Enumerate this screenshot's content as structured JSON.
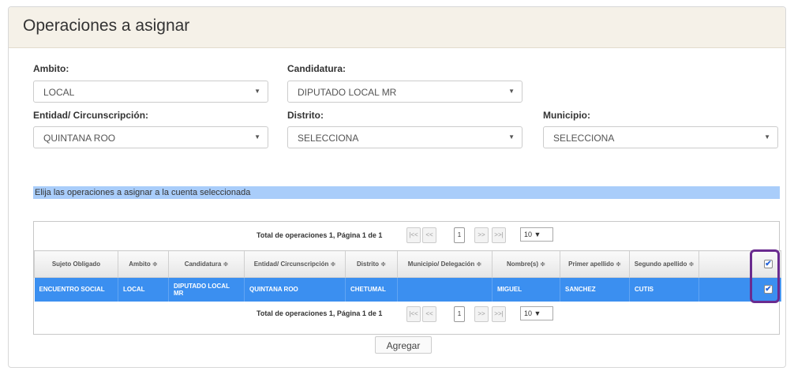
{
  "title": "Operaciones a asignar",
  "fields": {
    "ambito": {
      "label": "Ambito:",
      "value": "LOCAL"
    },
    "candidatura": {
      "label": "Candidatura:",
      "value": "DIPUTADO LOCAL MR"
    },
    "entidad": {
      "label": "Entidad/ Circunscripción:",
      "value": "QUINTANA ROO"
    },
    "distrito": {
      "label": "Distrito:",
      "value": "SELECCIONA"
    },
    "municipio": {
      "label": "Municipio:",
      "value": "SELECCIONA"
    }
  },
  "banner": "Elija las operaciones a asignar a la cuenta seleccionada",
  "pager": {
    "info": "Total de operaciones 1, Página 1 de 1",
    "first": "|<<",
    "prev": "<<",
    "page": "1",
    "next": ">>",
    "last": ">>|",
    "page_size": "10"
  },
  "table": {
    "headers": [
      "Sujeto Obligado",
      "Ambito ≑",
      "Candidatura ≑",
      "Entidad/ Circunscripción ≑",
      "Distrito ≑",
      "Municipio/ Delegación ≑",
      "Nombre(s) ≑",
      "Primer apellido ≑",
      "Segundo apellido ≑"
    ],
    "rows": [
      [
        "ENCUENTRO SOCIAL",
        "LOCAL",
        "DIPUTADO LOCAL MR",
        "QUINTANA ROO",
        "CHETUMAL",
        "",
        "MIGUEL",
        "SANCHEZ",
        "CUTIS"
      ]
    ]
  },
  "add_button": "Agregar",
  "colors": {
    "accent": "#3b8ff0",
    "banner": "#a9cdfa",
    "highlight": "#6a2b8f",
    "heading_bg": "#f5f1e8"
  }
}
